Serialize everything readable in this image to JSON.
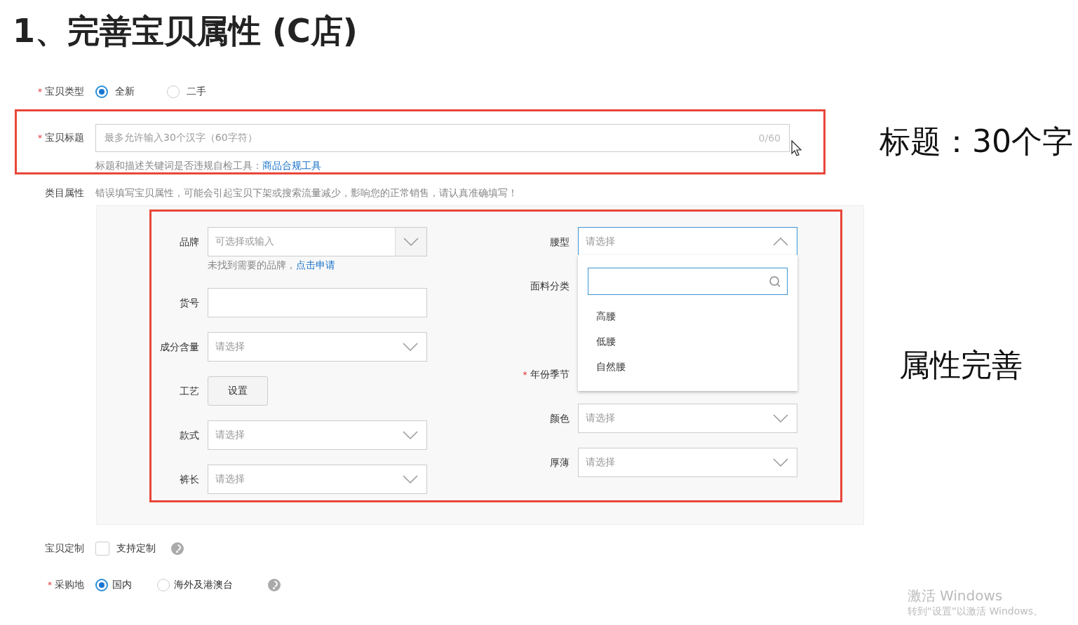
{
  "heading": "1、完善宝贝属性 (C店)",
  "item_type": {
    "required_mark": "*",
    "label": "宝贝类型",
    "options": [
      {
        "label": "全新",
        "selected": true
      },
      {
        "label": "二手",
        "selected": false
      }
    ]
  },
  "item_title": {
    "required_mark": "*",
    "label": "宝贝标题",
    "placeholder": "最多允许输入30个汉字（60字符）",
    "counter": "0/60",
    "hint": "标题和描述关键词是否违规自检工具：",
    "hint_link": "商品合规工具"
  },
  "title_note": "标题：30个字",
  "category": {
    "label": "类目属性",
    "notice": "错误填写宝贝属性，可能会引起宝贝下架或搜索流量减少，影响您的正常销售，请认真准确填写！"
  },
  "attributes_note": "属性完善",
  "left_fields": [
    {
      "label": "品牌",
      "kind": "combo",
      "placeholder": "可选择或输入",
      "hint": "未找到需要的品牌，",
      "hint_link": "点击申请"
    },
    {
      "label": "货号",
      "kind": "input"
    },
    {
      "label": "成分含量",
      "kind": "select",
      "placeholder": "请选择"
    },
    {
      "label": "工艺",
      "kind": "button",
      "button": "设置"
    },
    {
      "label": "款式",
      "kind": "select",
      "placeholder": "请选择"
    },
    {
      "label": "裤长",
      "kind": "select",
      "placeholder": "请选择"
    }
  ],
  "right_fields": [
    {
      "label": "腰型",
      "kind": "select",
      "placeholder": "请选择",
      "expanded": true,
      "options": [
        "高腰",
        "低腰",
        "自然腰"
      ]
    },
    {
      "label": "面料分类",
      "kind": "covered"
    },
    {
      "kind": "covered"
    },
    {
      "required_mark": "*",
      "label": "年份季节",
      "kind": "covered"
    },
    {
      "label": "颜色",
      "kind": "select",
      "placeholder": "请选择",
      "expanded": false
    },
    {
      "label": "厚薄",
      "kind": "select",
      "placeholder": "请选择",
      "expanded": false
    }
  ],
  "customize": {
    "label": "宝贝定制",
    "checked": false,
    "option": "支持定制"
  },
  "purchase": {
    "required_mark": "*",
    "label": "采购地",
    "options": [
      {
        "label": "国内",
        "selected": true
      },
      {
        "label": "海外及港澳台",
        "selected": false
      }
    ]
  },
  "windows": {
    "title": "激活 Windows",
    "subtitle": "转到“设置”以激活 Windows。"
  }
}
